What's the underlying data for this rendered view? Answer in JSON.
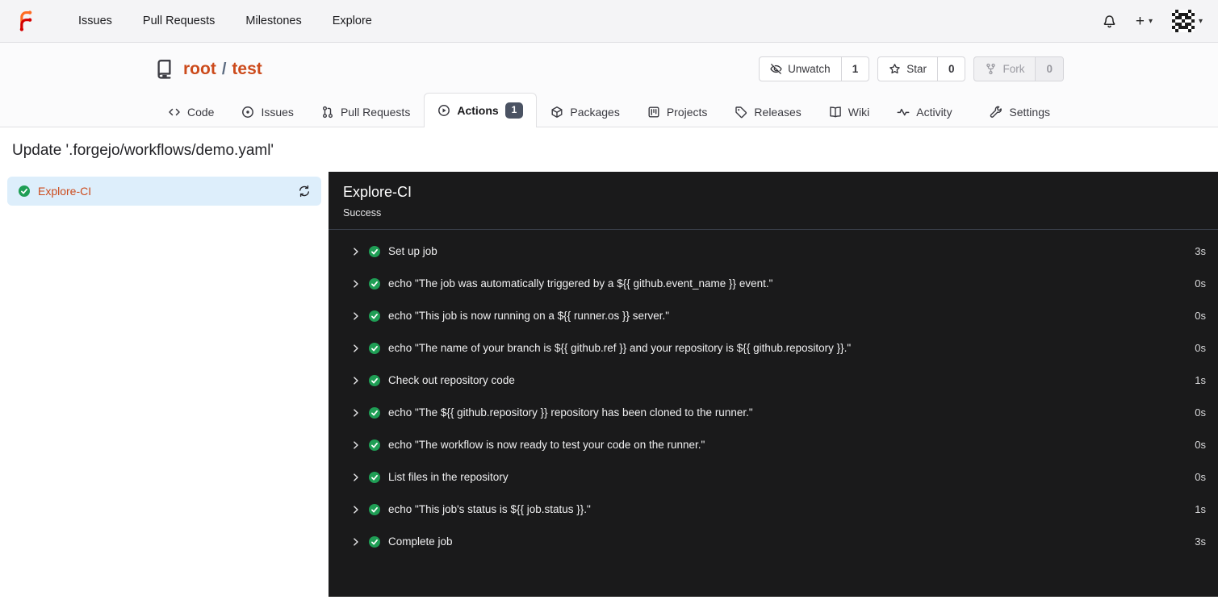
{
  "colors": {
    "primary": "#cc4b1c",
    "success_green": "#1f9e55",
    "panel_bg": "#1a1a1b",
    "selected_job_bg": "#ddeefb",
    "badge_bg": "#4b5363"
  },
  "glyphs": {
    "plus": "+",
    "caret": "▾"
  },
  "topnav": {
    "items": [
      {
        "label": "Issues",
        "name": "nav-item-issues"
      },
      {
        "label": "Pull Requests",
        "name": "nav-item-pull-requests"
      },
      {
        "label": "Milestones",
        "name": "nav-item-milestones"
      },
      {
        "label": "Explore",
        "name": "nav-item-explore"
      }
    ]
  },
  "repo_header": {
    "owner": "root",
    "separator": "/",
    "name": "test",
    "buttons": [
      {
        "label": "Unwatch",
        "count": "1",
        "icon": "eye-slash-icon",
        "name": "unwatch-button",
        "disabled": false
      },
      {
        "label": "Star",
        "count": "0",
        "icon": "star-icon",
        "name": "star-button",
        "disabled": false
      },
      {
        "label": "Fork",
        "count": "0",
        "icon": "fork-icon",
        "name": "fork-button",
        "disabled": true
      }
    ]
  },
  "tabs": [
    {
      "label": "Code",
      "icon": "code-icon",
      "name": "tab-code"
    },
    {
      "label": "Issues",
      "icon": "issues-icon",
      "name": "tab-issues"
    },
    {
      "label": "Pull Requests",
      "icon": "pull-request-icon",
      "name": "tab-pull-requests"
    },
    {
      "label": "Actions",
      "icon": "actions-icon",
      "name": "tab-actions",
      "badge": "1",
      "active": true
    },
    {
      "label": "Packages",
      "icon": "packages-icon",
      "name": "tab-packages"
    },
    {
      "label": "Projects",
      "icon": "projects-icon",
      "name": "tab-projects"
    },
    {
      "label": "Releases",
      "icon": "releases-icon",
      "name": "tab-releases"
    },
    {
      "label": "Wiki",
      "icon": "wiki-icon",
      "name": "tab-wiki"
    },
    {
      "label": "Activity",
      "icon": "activity-icon",
      "name": "tab-activity"
    },
    {
      "label": "Settings",
      "icon": "settings-icon",
      "name": "tab-settings",
      "right": true
    }
  ],
  "run": {
    "commit_title": "Update '.forgejo/workflows/demo.yaml'",
    "job": {
      "name": "Explore-CI",
      "status": "Success"
    },
    "steps": [
      {
        "name": "Set up job",
        "duration": "3s"
      },
      {
        "name": "echo \"The job was automatically triggered by a ${{ github.event_name }} event.\"",
        "duration": "0s"
      },
      {
        "name": "echo \"This job is now running on a ${{ runner.os }} server.\"",
        "duration": "0s"
      },
      {
        "name": "echo \"The name of your branch is ${{ github.ref }} and your repository is ${{ github.repository }}.\"",
        "duration": "0s"
      },
      {
        "name": "Check out repository code",
        "duration": "1s"
      },
      {
        "name": "echo \"The ${{ github.repository }} repository has been cloned to the runner.\"",
        "duration": "0s"
      },
      {
        "name": "echo \"The workflow is now ready to test your code on the runner.\"",
        "duration": "0s"
      },
      {
        "name": "List files in the repository",
        "duration": "0s"
      },
      {
        "name": "echo \"This job's status is ${{ job.status }}.\"",
        "duration": "1s"
      },
      {
        "name": "Complete job",
        "duration": "3s"
      }
    ]
  }
}
